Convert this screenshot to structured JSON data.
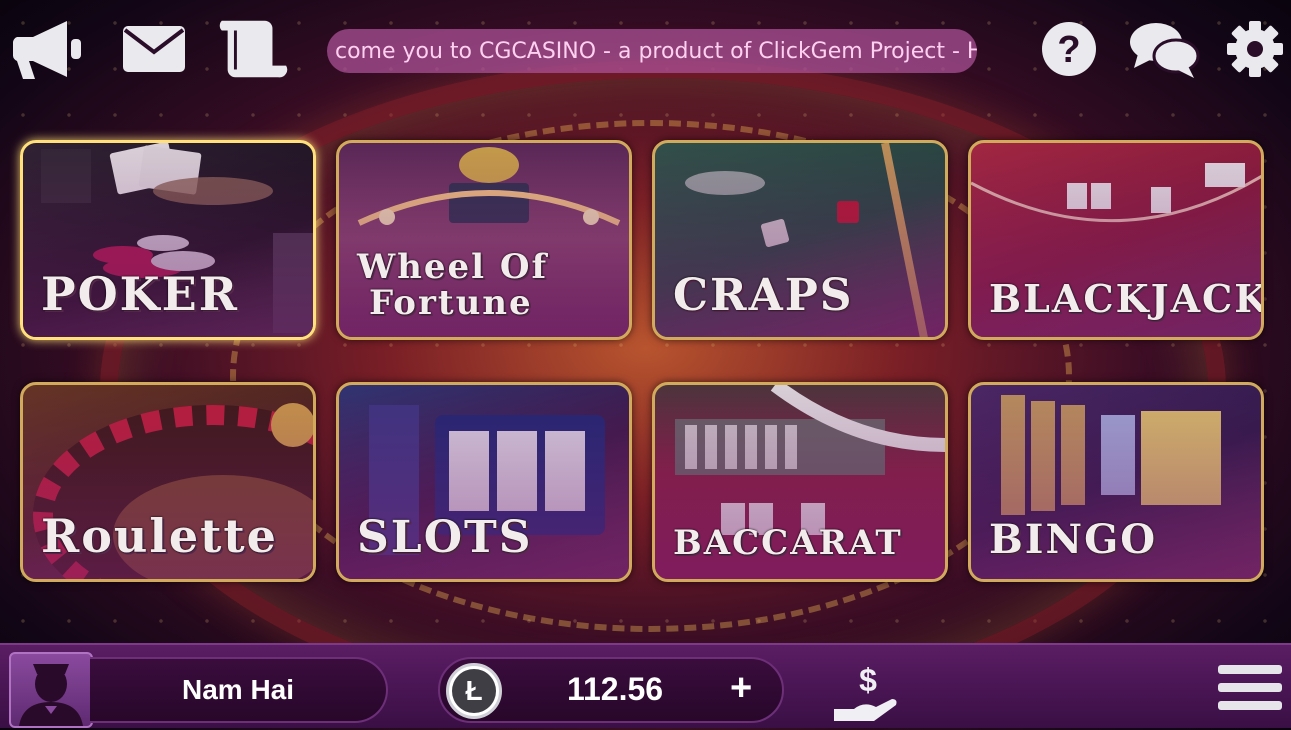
{
  "header": {
    "marquee_text": "come you to CGCASINO - a product of ClickGem Project - He",
    "icons": [
      "megaphone-icon",
      "mail-icon",
      "scroll-icon",
      "help-icon",
      "chat-icon",
      "gear-icon"
    ]
  },
  "games": [
    {
      "label": "POKER",
      "selected": true
    },
    {
      "label": "WHEEL OF FORTUNE",
      "line1": "Wheel Of",
      "line2": "Fortune"
    },
    {
      "label": "CRAPS"
    },
    {
      "label": "BLACKJACK"
    },
    {
      "label": "Roulette"
    },
    {
      "label": "SLOTS"
    },
    {
      "label": "BACCARAT"
    },
    {
      "label": "BINGO"
    }
  ],
  "footer": {
    "username": "Nam Hai",
    "currency_symbol": "Ł",
    "balance": "112.56",
    "add_label": "+",
    "cash_symbol": "$"
  },
  "colors": {
    "tile_border": "#d1aa5c",
    "selected_border": "#ffe07a",
    "footer_bg": "#4a1652",
    "marquee_bg": "#aa5096"
  }
}
